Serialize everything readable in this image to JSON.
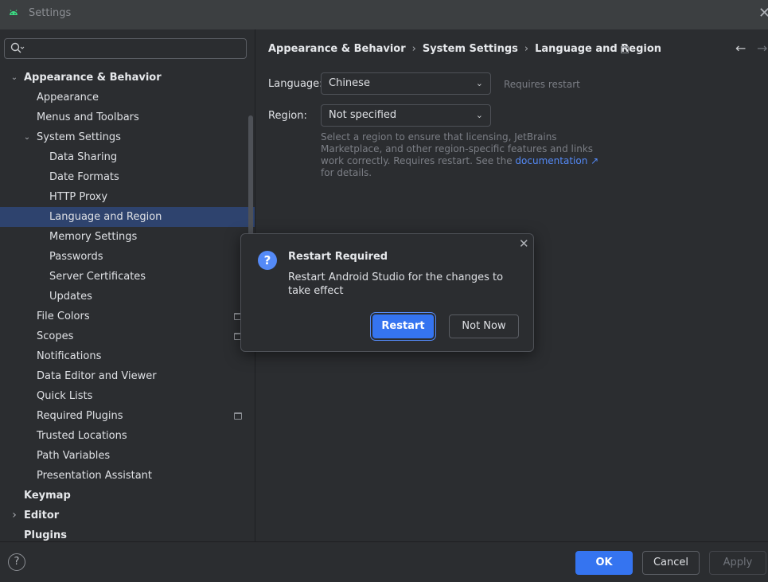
{
  "window": {
    "title": "Settings"
  },
  "search": {
    "placeholder": ""
  },
  "tree": [
    {
      "label": "Appearance & Behavior",
      "level": 0,
      "expanded": true,
      "bold": true
    },
    {
      "label": "Appearance",
      "level": 1
    },
    {
      "label": "Menus and Toolbars",
      "level": 1
    },
    {
      "label": "System Settings",
      "level": 1,
      "expanded": true
    },
    {
      "label": "Data Sharing",
      "level": 2
    },
    {
      "label": "Date Formats",
      "level": 2
    },
    {
      "label": "HTTP Proxy",
      "level": 2
    },
    {
      "label": "Language and Region",
      "level": 2,
      "selected": true
    },
    {
      "label": "Memory Settings",
      "level": 2
    },
    {
      "label": "Passwords",
      "level": 2
    },
    {
      "label": "Server Certificates",
      "level": 2
    },
    {
      "label": "Updates",
      "level": 2
    },
    {
      "label": "File Colors",
      "level": 1,
      "project_icon": true
    },
    {
      "label": "Scopes",
      "level": 1,
      "project_icon": true
    },
    {
      "label": "Notifications",
      "level": 1
    },
    {
      "label": "Data Editor and Viewer",
      "level": 1
    },
    {
      "label": "Quick Lists",
      "level": 1
    },
    {
      "label": "Required Plugins",
      "level": 1,
      "project_icon": true
    },
    {
      "label": "Trusted Locations",
      "level": 1
    },
    {
      "label": "Path Variables",
      "level": 1
    },
    {
      "label": "Presentation Assistant",
      "level": 1
    },
    {
      "label": "Keymap",
      "level": 0,
      "bold": true
    },
    {
      "label": "Editor",
      "level": 0,
      "bold": true,
      "collapsed": true
    },
    {
      "label": "Plugins",
      "level": 0,
      "bold": true
    }
  ],
  "breadcrumb": [
    "Appearance & Behavior",
    "System Settings",
    "Language and Region"
  ],
  "language": {
    "label": "Language:",
    "value": "Chinese",
    "hint": "Requires restart"
  },
  "region": {
    "label": "Region:",
    "value": "Not specified",
    "help_before": "Select a region to ensure that licensing, JetBrains Marketplace, and other region-specific features and links work correctly. Requires restart. See the ",
    "help_link": "documentation",
    "help_after": " for details."
  },
  "dialog": {
    "title": "Restart Required",
    "message": "Restart Android Studio for the changes to take effect",
    "restart_label": "Restart",
    "not_now_label": "Not Now"
  },
  "footer": {
    "ok_label": "OK",
    "cancel_label": "Cancel",
    "apply_label": "Apply"
  },
  "colors": {
    "accent": "#3574f0",
    "selection": "#2e436e",
    "link": "#548af7"
  }
}
